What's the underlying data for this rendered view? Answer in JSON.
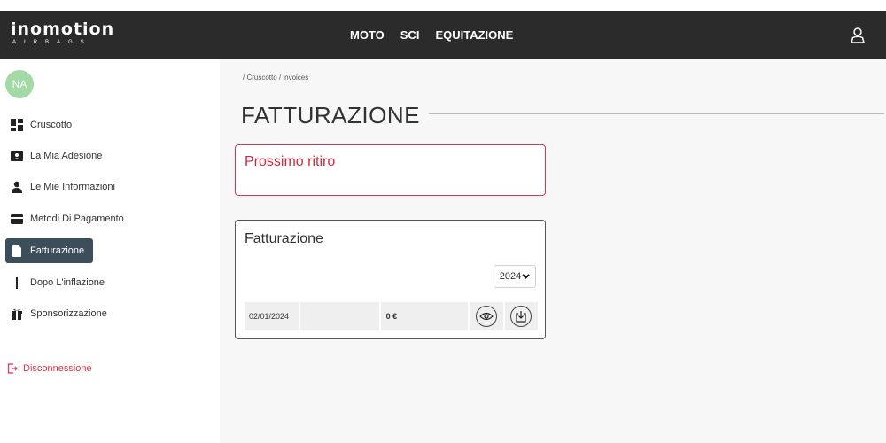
{
  "header": {
    "logo_main": "inomotion",
    "logo_sub": "AIRBAGS",
    "nav": [
      {
        "label": "MOTO"
      },
      {
        "label": "SCI"
      },
      {
        "label": "EQUITAZIONE"
      }
    ]
  },
  "sidebar": {
    "avatar_initials": "NA",
    "items": [
      {
        "label": "Cruscotto",
        "icon": "dashboard-icon"
      },
      {
        "label": "La Mia Adesione",
        "icon": "membership-card-icon"
      },
      {
        "label": "Le Mie Informazioni",
        "icon": "user-icon"
      },
      {
        "label": "Metodi Di Pagamento",
        "icon": "credit-card-icon"
      },
      {
        "label": "Fatturazione",
        "icon": "document-icon",
        "active": true
      },
      {
        "label": "Dopo L'inflazione",
        "icon": "bar-icon"
      },
      {
        "label": "Sponsorizzazione",
        "icon": "gift-icon"
      }
    ],
    "logout_label": "Disconnessione"
  },
  "main": {
    "breadcrumb": "/ Cruscotto / invoices",
    "title": "FATTURAZIONE",
    "next_pickup": {
      "title": "Prossimo ritiro"
    },
    "invoices": {
      "title": "Fatturazione",
      "year": "2024",
      "rows": [
        {
          "date": "02/01/2024",
          "blank": "",
          "amount": "0 €"
        }
      ]
    }
  },
  "colors": {
    "header_bg": "#2b2b2b",
    "accent_red": "#e0334a",
    "active_bg": "#3c4e5a",
    "avatar_bg": "#a3d9a5"
  }
}
